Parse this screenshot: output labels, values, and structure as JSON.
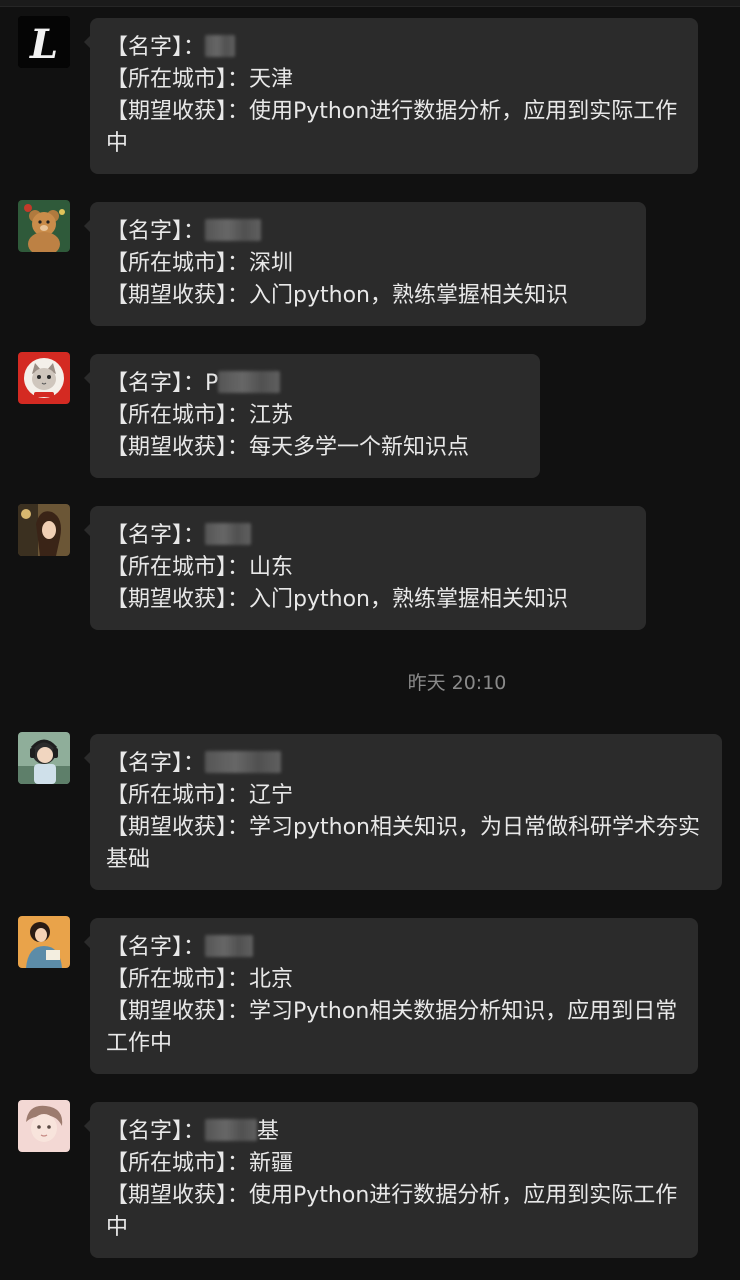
{
  "labels": {
    "name": "【名字】：",
    "city": "【所在城市】：",
    "goal": "【期望收获】："
  },
  "timestamp": "昨天 20:10",
  "messages": [
    {
      "avatar": "letter-l-avatar",
      "name_visible": "李贺",
      "city": "天津",
      "goal": "使用Python进行数据分析，应用到实际工作中"
    },
    {
      "avatar": "teddy-bear-avatar",
      "name_visible": "玉子",
      "city": "深圳",
      "goal": "入门python，熟练掌握相关知识"
    },
    {
      "avatar": "cat-avatar",
      "name_visible": "P",
      "city": "江苏",
      "goal": "每天多学一个新知识点"
    },
    {
      "avatar": "girl-portrait-avatar",
      "name_visible": "",
      "city": "山东",
      "goal": "入门python，熟练掌握相关知识"
    },
    {
      "avatar": "anime-headphones-avatar",
      "name_visible": "",
      "city": "辽宁",
      "goal": "学习python相关知识，为日常做科研学术夯实基础"
    },
    {
      "avatar": "girl-reading-avatar",
      "name_visible": "",
      "city": "北京",
      "goal": "学习Python相关数据分析知识，应用到日常工作中"
    },
    {
      "avatar": "anime-boy-avatar",
      "name_visible": "基",
      "city": "新疆",
      "goal": "使用Python进行数据分析，应用到实际工作中"
    }
  ]
}
